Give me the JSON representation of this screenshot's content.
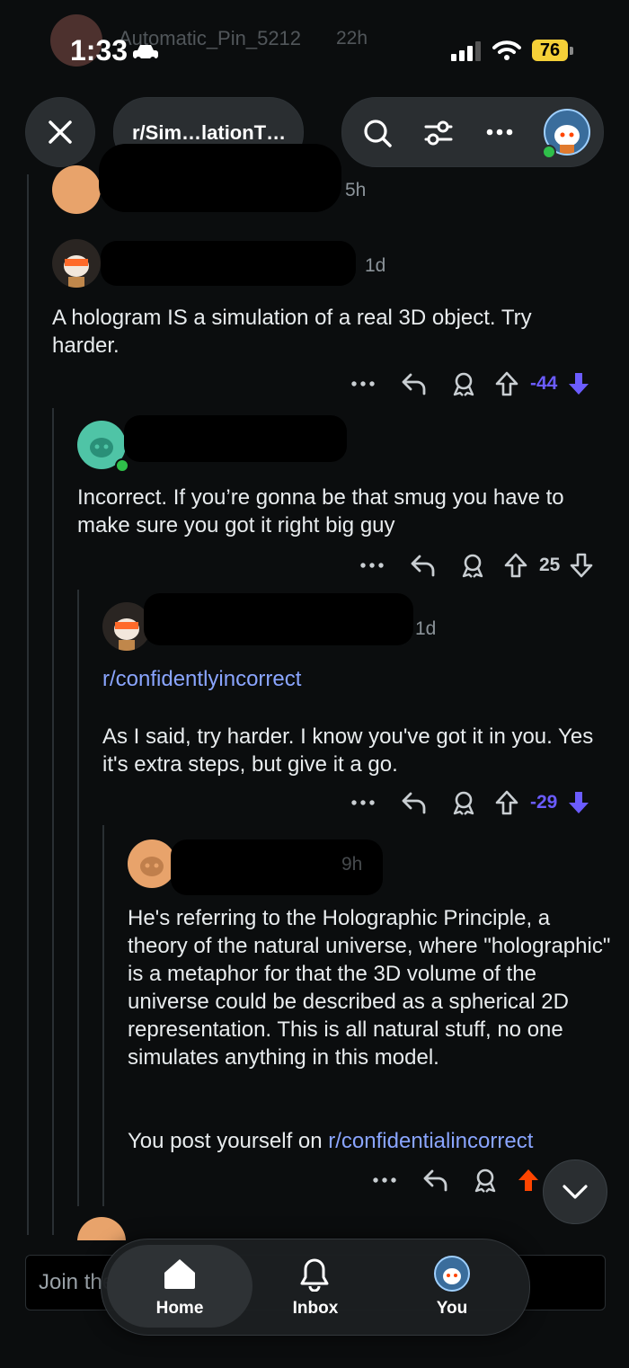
{
  "status": {
    "time": "1:33",
    "battery": "76"
  },
  "bg_header": {
    "username": "Automatic_Pin_5212",
    "age": "22h"
  },
  "toolbar": {
    "subreddit": "r/Sim…lationT…"
  },
  "colors": {
    "accent_link": "#8aa5ff",
    "downvote": "#6b5cff",
    "upvote_orange": "#ff4500",
    "background": "#0b0d0e"
  },
  "comments": [
    {
      "age": "5h"
    },
    {
      "age": "1d",
      "body": "A hologram IS a simulation of a real 3D object. Try harder.",
      "score": "-44",
      "vote": "down"
    },
    {
      "body": "Incorrect. If you’re gonna be that smug you have to make sure you got it right big guy",
      "score": "25",
      "vote": "none"
    },
    {
      "age": "1d",
      "link": "r/confidentlyincorrect",
      "body": "As I said, try harder. I know you've got it in you. Yes it's extra steps, but give it a go.",
      "score": "-29",
      "vote": "down"
    },
    {
      "age": "9h",
      "body": "He's referring to the Holographic Principle, a theory of the natural universe, where \"holographic\" is a metaphor for that the 3D volume of the universe could be described as a spherical 2D representation. This is all natural stuff, no one simulates anything in this model.",
      "body2_prefix": "You post yourself on ",
      "body2_link": "r/confidentialincorrect",
      "vote": "up"
    }
  ],
  "join_placeholder": "Join the conversation",
  "nav": [
    {
      "label": "Home"
    },
    {
      "label": "Inbox"
    },
    {
      "label": "You"
    }
  ]
}
